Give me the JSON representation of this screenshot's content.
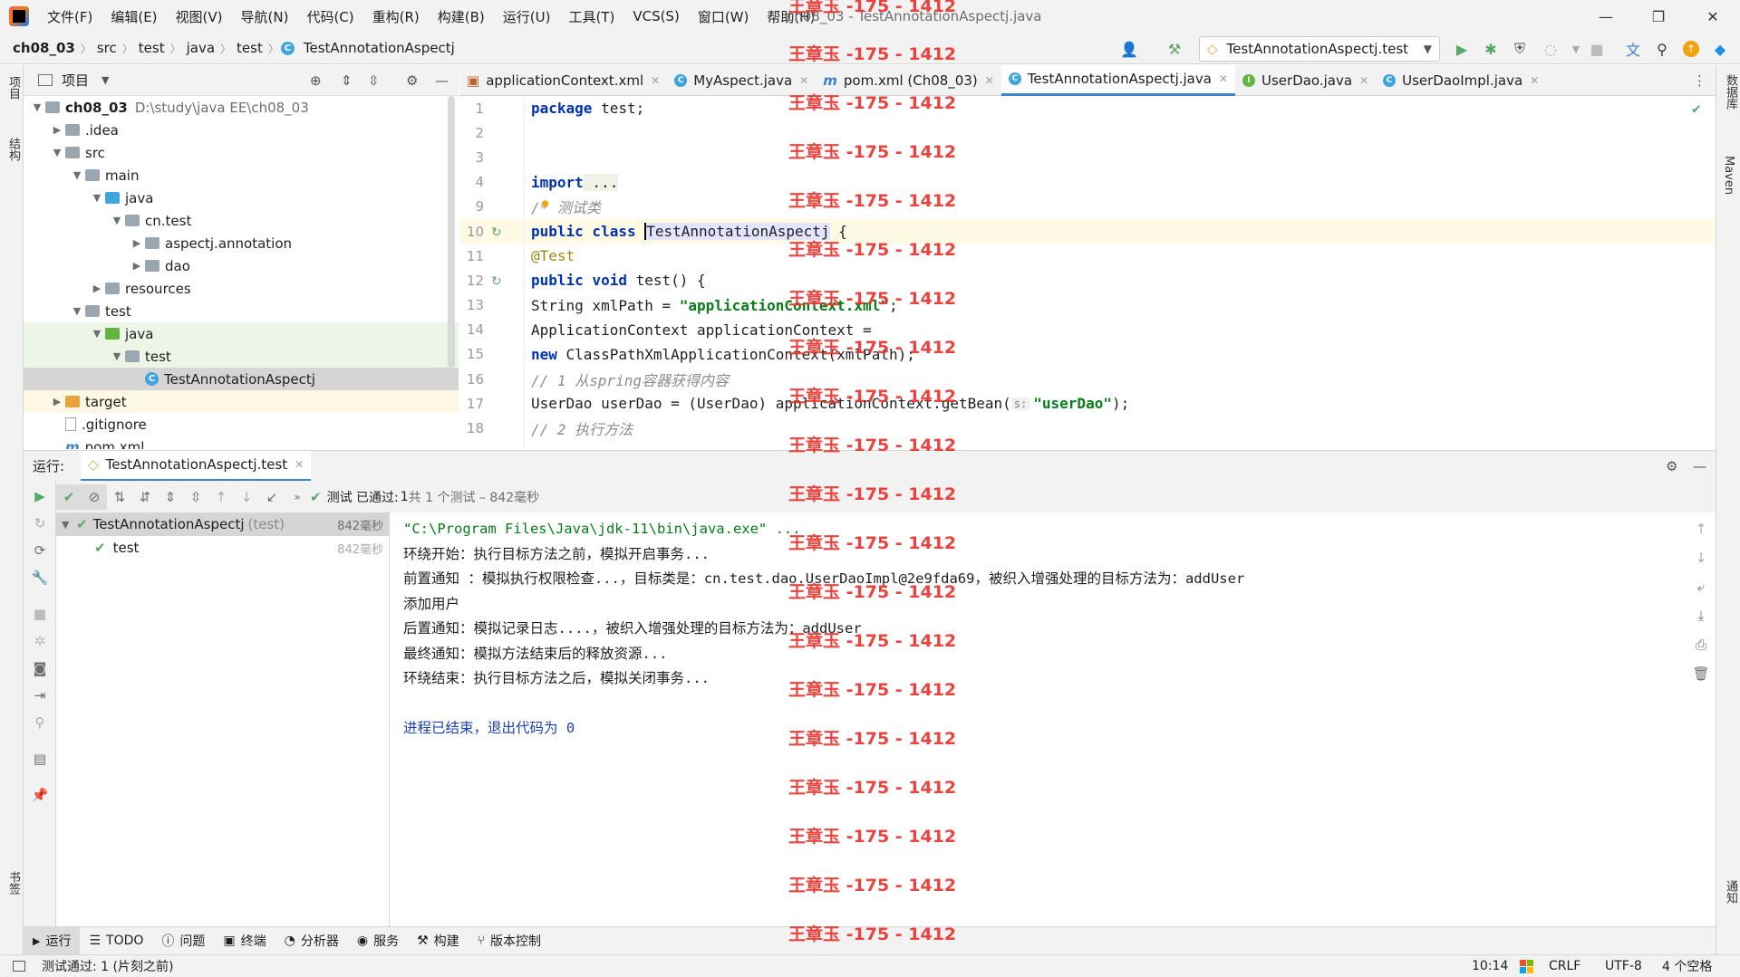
{
  "menubar": {
    "items": [
      "文件(F)",
      "编辑(E)",
      "视图(V)",
      "导航(N)",
      "代码(C)",
      "重构(R)",
      "构建(B)",
      "运行(U)",
      "工具(T)",
      "VCS(S)",
      "窗口(W)",
      "帮助(H)"
    ],
    "window_title": "ch08_03 - TestAnnotationAspectj.java"
  },
  "navbar": {
    "crumbs": [
      "ch08_03",
      "src",
      "test",
      "java",
      "test",
      "TestAnnotationAspectj"
    ],
    "run_config": "TestAnnotationAspectj.test"
  },
  "left_stripe": {
    "project": "项目",
    "structure": "结构",
    "bookmarks": "书签"
  },
  "right_stripe": {
    "database": "数据库",
    "maven": "Maven",
    "notifications": "通知"
  },
  "project_panel": {
    "title": "项目",
    "root_name": "ch08_03",
    "root_path": "D:\\study\\java EE\\ch08_03",
    "nodes": [
      {
        "label": ".idea"
      },
      {
        "label": "src"
      },
      {
        "label": "main"
      },
      {
        "label": "java"
      },
      {
        "label": "cn.test"
      },
      {
        "label": "aspectj.annotation"
      },
      {
        "label": "dao"
      },
      {
        "label": "resources"
      },
      {
        "label": "test"
      },
      {
        "label": "java"
      },
      {
        "label": "test"
      },
      {
        "label": "TestAnnotationAspectj"
      },
      {
        "label": "target"
      },
      {
        "label": ".gitignore"
      },
      {
        "label": "pom.xml"
      }
    ]
  },
  "editor_tabs": [
    {
      "label": "applicationContext.xml"
    },
    {
      "label": "MyAspect.java"
    },
    {
      "label": "pom.xml (Ch08_03)"
    },
    {
      "label": "TestAnnotationAspectj.java"
    },
    {
      "label": "UserDao.java"
    },
    {
      "label": "UserDaoImpl.java"
    }
  ],
  "editor": {
    "line_numbers": [
      "1",
      "2",
      "3",
      "4",
      "9",
      "10",
      "11",
      "12",
      "13",
      "14",
      "15",
      "16",
      "17",
      "18"
    ],
    "code": {
      "l1_kw": "package",
      "l1_rest": " test;",
      "l4_kw": "import",
      "l4_rest": " ...",
      "l9": "/* 测试类",
      "l10_kw": "public class",
      "l10_name": "TestAnnotationAspectj",
      "l10_rest": " {",
      "l11": "@Test",
      "l12_kw": "public void",
      "l12_rest": " test() {",
      "l13_a": "String xmlPath = ",
      "l13_str": "\"applicationContext.xml\"",
      "l13_b": ";",
      "l14": "ApplicationContext applicationContext =",
      "l15_kw": "new",
      "l15_rest": " ClassPathXmlApplicationContext(xmlPath);",
      "l16": "// 1 从spring容器获得内容",
      "l17_a": "UserDao userDao = (UserDao) applicationContext.getBean(",
      "l17_hint": "s:",
      "l17_str": "\"userDao\"",
      "l17_b": ");",
      "l18": "// 2 执行方法"
    }
  },
  "run_panel": {
    "label": "运行:",
    "tab": "TestAnnotationAspectj.test",
    "status_prefix": "测试 已通过:",
    "status_count": "1",
    "status_suffix": "共 1 个测试 – 842毫秒",
    "tree": {
      "root": "TestAnnotationAspectj",
      "root_suffix": "(test)",
      "root_time": "842毫秒",
      "child": "test",
      "child_time": "842毫秒"
    },
    "console_lines": [
      "\"C:\\Program Files\\Java\\jdk-11\\bin\\java.exe\" ...",
      "环绕开始：执行目标方法之前，模拟开启事务...",
      "前置通知 ：模拟执行权限检查...，目标类是：cn.test.dao.UserDaoImpl@2e9fda69，被织入增强处理的目标方法为：addUser",
      "添加用户",
      "后置通知：模拟记录日志....，被织入增强处理的目标方法为：addUser",
      "最终通知：模拟方法结束后的释放资源...",
      "环绕结束：执行目标方法之后，模拟关闭事务...",
      "",
      "进程已结束，退出代码为 0"
    ]
  },
  "bottom_tabs": [
    "运行",
    "TODO",
    "问题",
    "终端",
    "分析器",
    "服务",
    "构建",
    "版本控制"
  ],
  "status_bar": {
    "message": "测试通过: 1 (片刻之前)",
    "position": "10:14",
    "line_sep": "CRLF",
    "encoding": "UTF-8",
    "indent": "4 个空格"
  },
  "watermark": "王章玉 -175 - 1412",
  "colors": {
    "accent": "#4083c9",
    "keyword": "#0033b3",
    "string": "#067d17",
    "pass": "#59a869",
    "watermark": "#e8352e"
  }
}
